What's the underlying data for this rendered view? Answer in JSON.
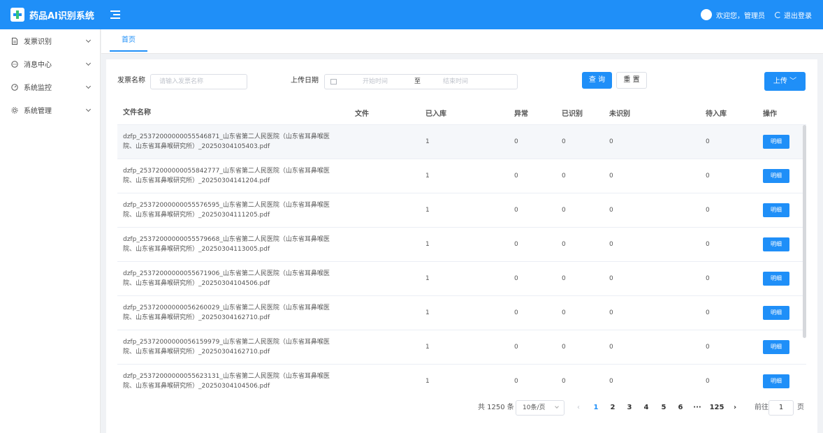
{
  "app": {
    "title": "药品AI识别系统"
  },
  "header": {
    "welcome": "欢迎您，管理员",
    "logout_label": "退出登录"
  },
  "sidebar": {
    "items": [
      {
        "label": "发票识别",
        "icon": "document-icon"
      },
      {
        "label": "消息中心",
        "icon": "message-icon"
      },
      {
        "label": "系统监控",
        "icon": "monitor-icon"
      },
      {
        "label": "系统管理",
        "icon": "gear-icon"
      }
    ]
  },
  "tabs": [
    {
      "label": "首页"
    }
  ],
  "search": {
    "name_label": "发票名称",
    "name_placeholder": "请输入发票名称",
    "date_label": "上传日期",
    "start_placeholder": "开始时间",
    "range_sep": "至",
    "end_placeholder": "结束时间",
    "query_label": "查 询",
    "reset_label": "重 置",
    "upload_label": "上传 ﹀"
  },
  "table": {
    "columns": [
      "文件名称",
      "文件",
      "已入库",
      "异常",
      "已识别",
      "未识别",
      "待入库",
      "操作"
    ],
    "detail_label": "明细",
    "rows": [
      {
        "name": "dzfp_25372000000055546871_山东省第二人民医院（山东省耳鼻喉医院、山东省耳鼻喉研究所）_20250304105403.pdf",
        "file": "",
        "stored": "1",
        "error": "0",
        "recognized": "0",
        "unrecognized": "0",
        "pending": "0"
      },
      {
        "name": "dzfp_25372000000055842777_山东省第二人民医院（山东省耳鼻喉医院、山东省耳鼻喉研究所）_20250304141204.pdf",
        "file": "",
        "stored": "1",
        "error": "0",
        "recognized": "0",
        "unrecognized": "0",
        "pending": "0"
      },
      {
        "name": "dzfp_25372000000055576595_山东省第二人民医院（山东省耳鼻喉医院、山东省耳鼻喉研究所）_20250304111205.pdf",
        "file": "",
        "stored": "1",
        "error": "0",
        "recognized": "0",
        "unrecognized": "0",
        "pending": "0"
      },
      {
        "name": "dzfp_25372000000055579668_山东省第二人民医院（山东省耳鼻喉医院、山东省耳鼻喉研究所）_20250304113005.pdf",
        "file": "",
        "stored": "1",
        "error": "0",
        "recognized": "0",
        "unrecognized": "0",
        "pending": "0"
      },
      {
        "name": "dzfp_25372000000055671906_山东省第二人民医院（山东省耳鼻喉医院、山东省耳鼻喉研究所）_20250304104506.pdf",
        "file": "",
        "stored": "1",
        "error": "0",
        "recognized": "0",
        "unrecognized": "0",
        "pending": "0"
      },
      {
        "name": "dzfp_25372000000056260029_山东省第二人民医院（山东省耳鼻喉医院、山东省耳鼻喉研究所）_20250304162710.pdf",
        "file": "",
        "stored": "1",
        "error": "0",
        "recognized": "0",
        "unrecognized": "0",
        "pending": "0"
      },
      {
        "name": "dzfp_25372000000056159979_山东省第二人民医院（山东省耳鼻喉医院、山东省耳鼻喉研究所）_20250304162710.pdf",
        "file": "",
        "stored": "1",
        "error": "0",
        "recognized": "0",
        "unrecognized": "0",
        "pending": "0"
      },
      {
        "name": "dzfp_25372000000055623131_山东省第二人民医院（山东省耳鼻喉医院、山东省耳鼻喉研究所）_20250304104506.pdf",
        "file": "",
        "stored": "1",
        "error": "0",
        "recognized": "0",
        "unrecognized": "0",
        "pending": "0"
      }
    ]
  },
  "pagination": {
    "total": "共 1250 条",
    "page_size": "10条/页",
    "prev": "‹",
    "next": "›",
    "pages": [
      "1",
      "2",
      "3",
      "4",
      "5",
      "6",
      "···",
      "125"
    ],
    "goto_label": "前往",
    "goto_value": "1",
    "goto_suffix": "页"
  },
  "colors": {
    "primary": "#1f8ff8",
    "sidebar_bg": "#ffffff",
    "page_bg": "#f0f2f5"
  }
}
